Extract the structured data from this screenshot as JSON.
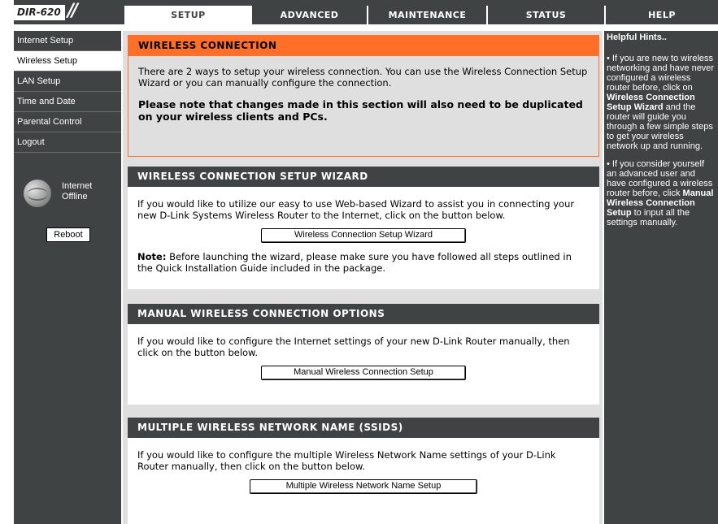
{
  "logo": {
    "model": "DIR-620",
    "slashes": "//"
  },
  "tabs": [
    {
      "label": "SETUP",
      "active": true
    },
    {
      "label": "ADVANCED",
      "active": false
    },
    {
      "label": "MAINTENANCE",
      "active": false
    },
    {
      "label": "STATUS",
      "active": false
    },
    {
      "label": "HELP",
      "active": false
    }
  ],
  "sidebar": {
    "items": [
      {
        "label": "Internet Setup"
      },
      {
        "label": "Wireless Setup"
      },
      {
        "label": "LAN Setup"
      },
      {
        "label": "Time and Date"
      },
      {
        "label": "Parental Control"
      },
      {
        "label": "Logout"
      }
    ],
    "status_line1": "Internet",
    "status_line2": "Offline",
    "reboot_label": "Reboot"
  },
  "main": {
    "wireless_connection": {
      "title": "WIRELESS CONNECTION",
      "intro": "There are 2 ways to setup your wireless connection. You can use the Wireless Connection Setup Wizard or you can manually configure the connection.",
      "note": "Please note that changes made in this section will also need to be duplicated on your wireless clients and PCs."
    },
    "wizard": {
      "title": "WIRELESS CONNECTION SETUP WIZARD",
      "text": "If you would like to utilize our easy to use Web-based Wizard to assist you in connecting your new D-Link Systems Wireless Router to the Internet, click on the button below.",
      "button": "Wireless Connection Setup Wizard",
      "note_label": "Note:",
      "note_text": " Before launching the wizard, please make sure you have followed all steps outlined in the Quick Installation Guide included in the package."
    },
    "manual": {
      "title": "MANUAL WIRELESS CONNECTION OPTIONS",
      "text": "If you would like to configure the Internet settings of your new D-Link Router manually, then click on the button below.",
      "button": "Manual Wireless Connection Setup"
    },
    "multi_ssid": {
      "title": "MULTIPLE WIRELESS NETWORK NAME (SSIDS)",
      "text": "If you would like to configure the multiple Wireless Network Name settings of your D-Link Router manually, then click on the button below.",
      "button": "Multiple Wireless Network Name Setup"
    }
  },
  "help": {
    "title": "Helpful Hints..",
    "hint1_a": "• If you are new to wireless networking and have never configured a wireless router before, click on ",
    "hint1_bold": "Wireless Connection Setup Wizard",
    "hint1_b": " and the router will guide you through a few simple steps to get your wireless network up and running.",
    "hint2_a": "• If you consider yourself an advanced user and have configured a wireless router before, click ",
    "hint2_bold": "Manual Wireless Connection Setup",
    "hint2_b": " to input all the settings manually."
  },
  "colors": {
    "dark": "#404343",
    "accent_orange": "#ff6f28",
    "content_bg": "#dfdfdf"
  }
}
